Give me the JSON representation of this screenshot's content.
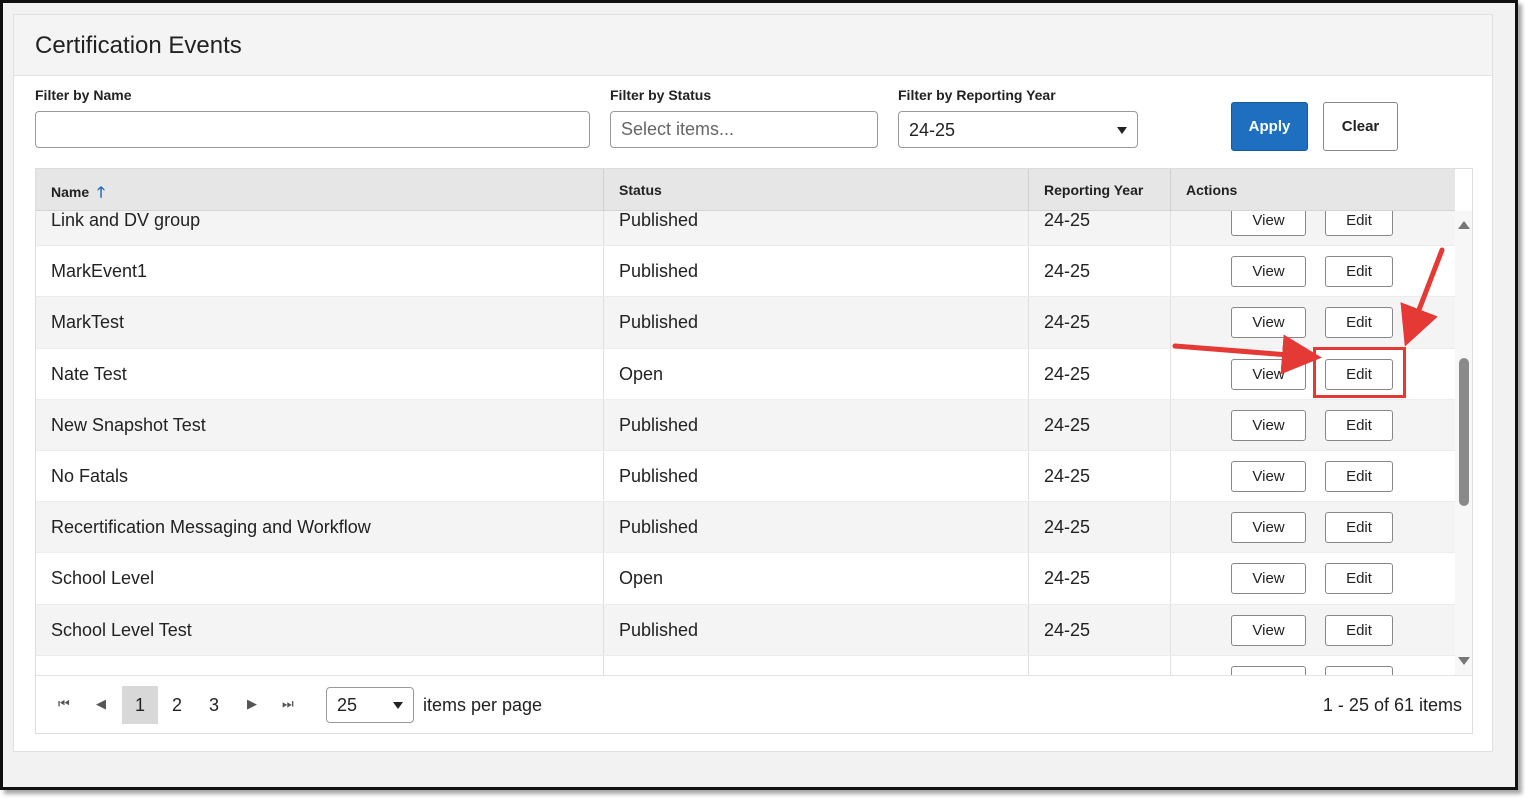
{
  "page": {
    "title": "Certification Events"
  },
  "filters": {
    "name_label": "Filter by Name",
    "name_value": "",
    "status_label": "Filter by Status",
    "status_placeholder": "Select items...",
    "year_label": "Filter by Reporting Year",
    "year_value": "24-25",
    "apply_label": "Apply",
    "clear_label": "Clear"
  },
  "table": {
    "columns": [
      {
        "label": "Name",
        "sorted": "ascending"
      },
      {
        "label": "Status"
      },
      {
        "label": "Reporting Year"
      },
      {
        "label": "Actions"
      }
    ],
    "view_label": "View",
    "edit_label": "Edit",
    "rows": [
      {
        "name": "Link and DV group",
        "status": "Published",
        "year": "24-25"
      },
      {
        "name": "MarkEvent1",
        "status": "Published",
        "year": "24-25"
      },
      {
        "name": "MarkTest",
        "status": "Published",
        "year": "24-25"
      },
      {
        "name": "Nate Test",
        "status": "Open",
        "year": "24-25"
      },
      {
        "name": "New Snapshot Test",
        "status": "Published",
        "year": "24-25"
      },
      {
        "name": "No Fatals",
        "status": "Published",
        "year": "24-25"
      },
      {
        "name": "Recertification Messaging and Workflow",
        "status": "Published",
        "year": "24-25"
      },
      {
        "name": "School Level",
        "status": "Open",
        "year": "24-25"
      },
      {
        "name": "School Level Test",
        "status": "Published",
        "year": "24-25"
      },
      {
        "name": "",
        "status": "",
        "year": ""
      }
    ]
  },
  "pager": {
    "pages": [
      "1",
      "2",
      "3"
    ],
    "current_page": "1",
    "page_size": "25",
    "items_per_page_label": "items per page",
    "info": "1 - 25 of 61 items"
  },
  "annotation": {
    "color": "#e53935",
    "highlighted_row": "Nate Test",
    "highlighted_action": "Edit"
  },
  "colors": {
    "primary": "#1e6fbf",
    "header_bg": "#e6e6e6",
    "alt_row": "#f4f4f4"
  }
}
